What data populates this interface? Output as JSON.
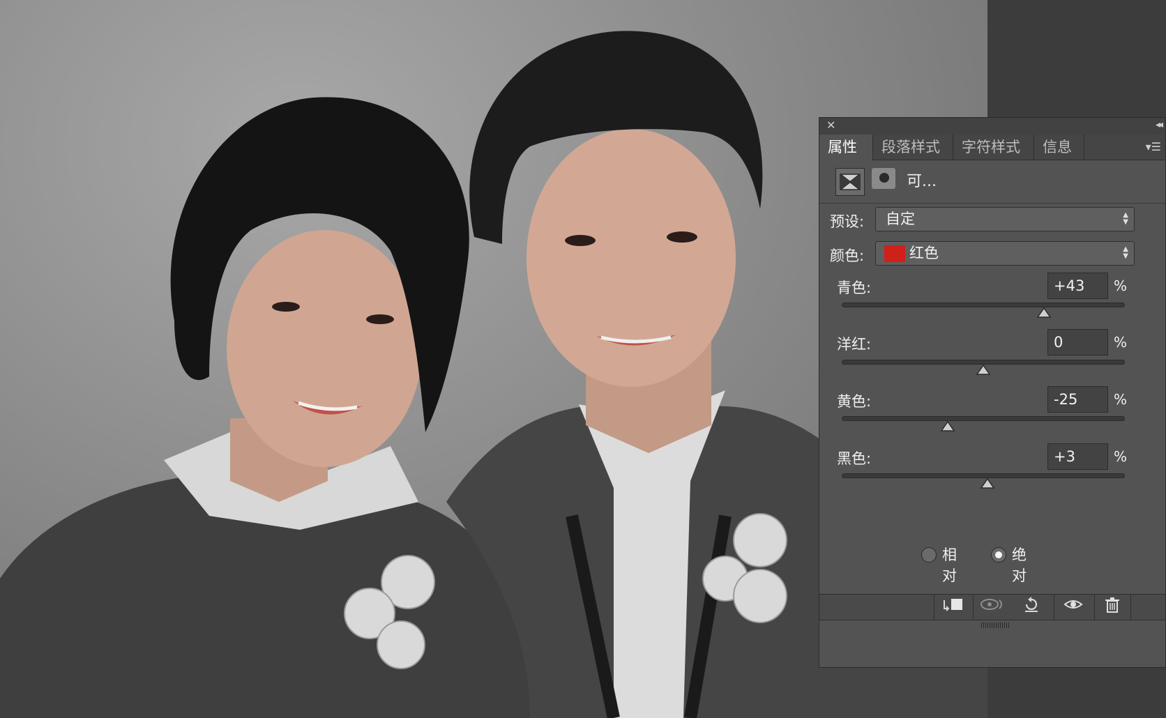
{
  "panel": {
    "tabs": [
      {
        "label": "属性",
        "active": true
      },
      {
        "label": "段落样式",
        "active": false
      },
      {
        "label": "字符样式",
        "active": false
      },
      {
        "label": "信息",
        "active": false
      }
    ],
    "adjustment_name": "可...",
    "preset": {
      "label": "预设:",
      "value": "自定"
    },
    "colors": {
      "label": "颜色:",
      "value": "红色",
      "swatch": "#d0201a"
    },
    "sliders": [
      {
        "label": "青色:",
        "value": "+43",
        "unit": "%",
        "level": 43
      },
      {
        "label": "洋红:",
        "value": "0",
        "unit": "%",
        "level": 0
      },
      {
        "label": "黄色:",
        "value": "-25",
        "unit": "%",
        "level": -25
      },
      {
        "label": "黑色:",
        "value": "+3",
        "unit": "%",
        "level": 3
      }
    ],
    "method": {
      "relative_label": "相对",
      "absolute_label": "绝对",
      "selected": "absolute"
    }
  },
  "theme": {
    "panel_bg": "#535353",
    "workspace_bg": "#3c3c3c"
  }
}
